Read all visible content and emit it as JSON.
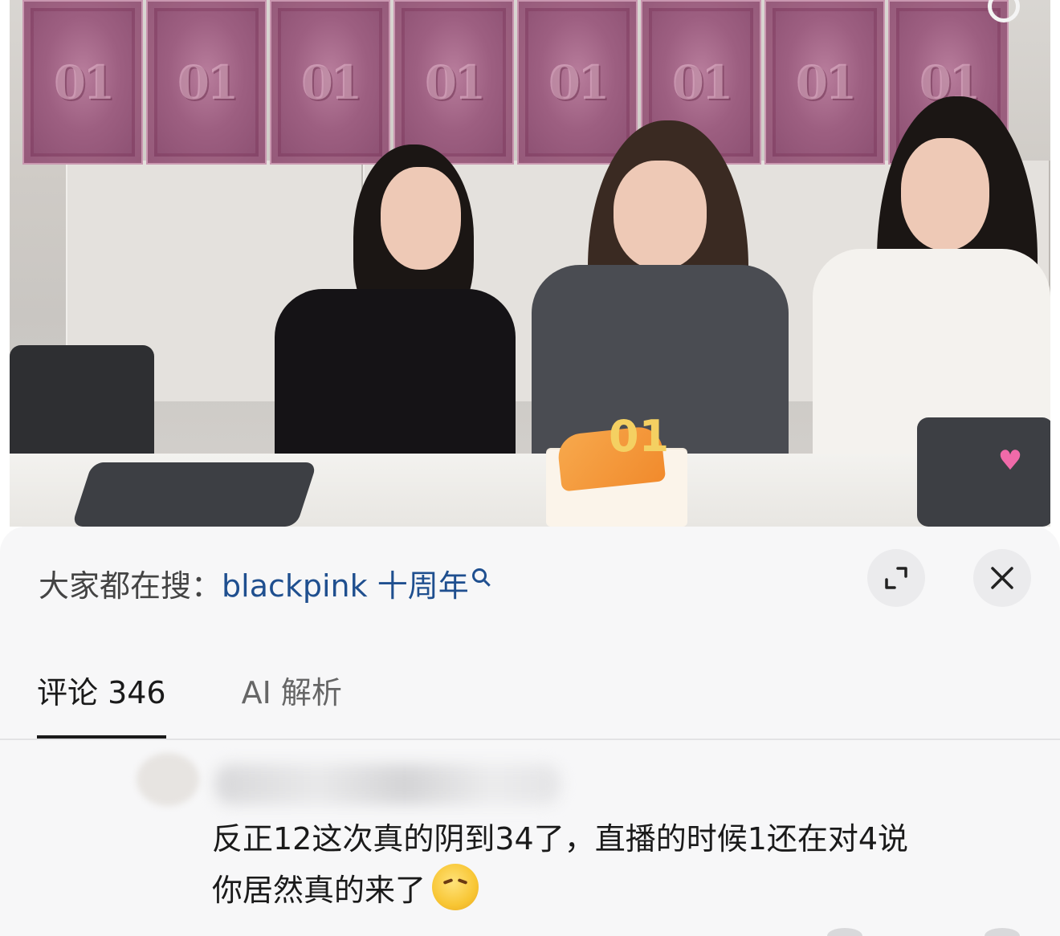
{
  "video": {
    "poster_text": "01",
    "cake_candles": "01"
  },
  "search_bar": {
    "prefix": "大家都在搜：",
    "term": "blackpink 十周年"
  },
  "tabs": [
    {
      "label": "评论 346",
      "active": true
    },
    {
      "label": "AI 解析",
      "active": false
    }
  ],
  "comment": {
    "text_line1": "反正12这次真的阴到34了，直播的时候1还在对4说",
    "text_line2": "你居然真的来了"
  }
}
